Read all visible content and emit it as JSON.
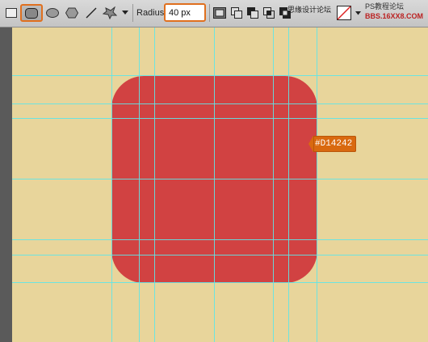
{
  "toolbar": {
    "tools": [
      {
        "name": "rectangle-tool-icon",
        "selected": false
      },
      {
        "name": "rounded-rectangle-tool-icon",
        "selected": true
      },
      {
        "name": "ellipse-tool-icon",
        "selected": false
      },
      {
        "name": "polygon-tool-icon",
        "selected": false
      },
      {
        "name": "line-tool-icon",
        "selected": false
      },
      {
        "name": "custom-shape-tool-icon",
        "selected": false
      },
      {
        "name": "chevron-down-icon",
        "selected": false
      }
    ],
    "radius_label": "Radius:",
    "radius_value": "40 px",
    "path_ops": [
      "new-layer-icon",
      "combine-icon",
      "subtract-icon",
      "intersect-icon",
      "exclude-icon"
    ],
    "style_swatch": "style-none-swatch"
  },
  "watermark": {
    "line1": "思缘设计论坛",
    "line2": "PS教程论坛",
    "line3": "BBS.16XX8.COM"
  },
  "canvas": {
    "background": "#e8d59b",
    "shape_color": "#d14242",
    "guide_color": "#5fe6e8"
  },
  "color_tag": {
    "label": "#D14242"
  }
}
